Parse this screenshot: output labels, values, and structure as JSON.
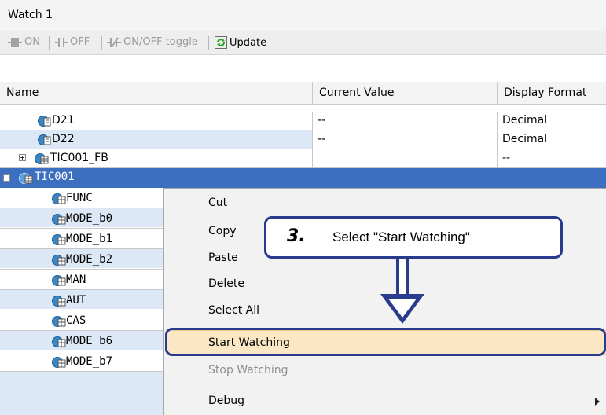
{
  "window": {
    "title": "Watch 1"
  },
  "toolbar": {
    "on_label": "ON",
    "off_label": "OFF",
    "toggle_label": "ON/OFF toggle",
    "update_label": "Update"
  },
  "table": {
    "columns": [
      "Name",
      "Current Value",
      "Display Format"
    ],
    "rows": [
      {
        "name": "D21",
        "value": "--",
        "format": "Decimal"
      },
      {
        "name": "D22",
        "value": "--",
        "format": "Decimal"
      },
      {
        "name": "TIC001_FB",
        "value": "",
        "format": "--"
      },
      {
        "name": "TIC001",
        "value": "",
        "format": ""
      },
      {
        "name": "FUNC"
      },
      {
        "name": "MODE_b0"
      },
      {
        "name": "MODE_b1"
      },
      {
        "name": "MODE_b2"
      },
      {
        "name": "MAN"
      },
      {
        "name": "AUT"
      },
      {
        "name": "CAS"
      },
      {
        "name": "MODE_b6"
      },
      {
        "name": "MODE_b7"
      }
    ]
  },
  "context_menu": {
    "cut": "Cut",
    "copy": "Copy",
    "paste": "Paste",
    "delete": "Delete",
    "select_all": "Select All",
    "start_watching": "Start Watching",
    "stop_watching": "Stop Watching",
    "debug": "Debug"
  },
  "callout": {
    "step": "3.",
    "text": "Select \"Start Watching\""
  },
  "colors": {
    "selected_row": "#3d6fc0",
    "highlight": "#fbe7c4",
    "callout_border": "#283b8c"
  }
}
